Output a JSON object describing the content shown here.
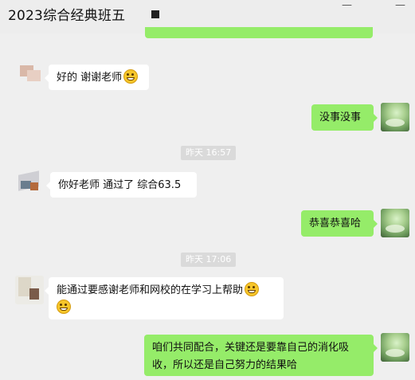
{
  "window": {
    "title": "2023综合经典班五",
    "btn_one": "—",
    "btn_two": "—"
  },
  "messages": [
    {
      "side": "in",
      "text": "好的 谢谢老师"
    },
    {
      "side": "out",
      "text": "没事没事"
    },
    {
      "side": "in",
      "text": "你好老师 通过了 综合63.5"
    },
    {
      "side": "out",
      "text": "恭喜恭喜哈"
    },
    {
      "side": "in",
      "text": "能通过要感谢老师和网校的在学习上帮助"
    },
    {
      "side": "out",
      "text": "咱们共同配合，关键还是要靠自己的消化吸收，所以还是自己努力的结果哈"
    }
  ],
  "timestamps": [
    "昨天 16:57",
    "昨天 17:06"
  ],
  "emoji_name": "grin-emoji",
  "colors": {
    "outgoing_bubble": "#95ec69",
    "incoming_bubble": "#ffffff",
    "background": "#efefef"
  }
}
